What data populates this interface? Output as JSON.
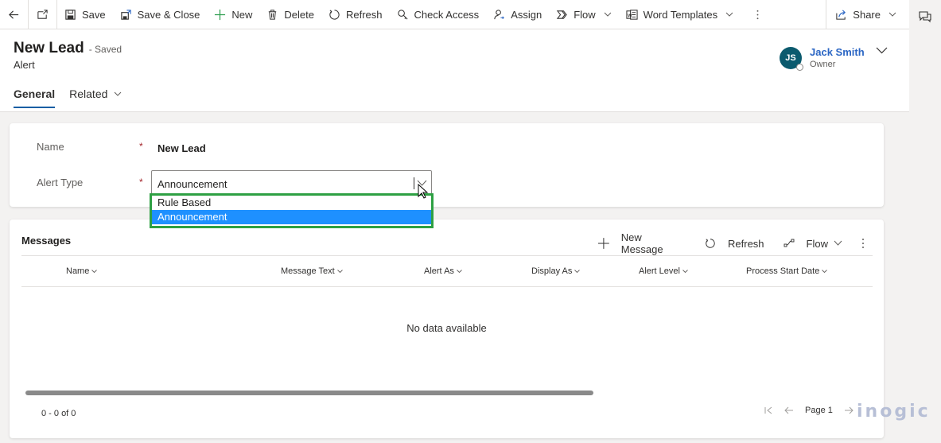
{
  "toolbar": {
    "back_icon": "arrow-left-icon",
    "popout_icon": "open-in-new-window-icon",
    "items": [
      {
        "label": "Save",
        "icon": "save-icon"
      },
      {
        "label": "Save & Close",
        "icon": "save-close-icon"
      },
      {
        "label": "New",
        "icon": "plus-icon"
      },
      {
        "label": "Delete",
        "icon": "trash-icon"
      },
      {
        "label": "Refresh",
        "icon": "refresh-icon"
      },
      {
        "label": "Check Access",
        "icon": "key-search-icon"
      },
      {
        "label": "Assign",
        "icon": "person-assign-icon"
      },
      {
        "label": "Flow",
        "icon": "flow-icon",
        "has_dropdown": true
      },
      {
        "label": "Word Templates",
        "icon": "word-icon",
        "has_dropdown": true
      }
    ],
    "more_icon": "more-vertical-icon",
    "share": {
      "label": "Share",
      "icon": "share-icon",
      "has_dropdown": true
    }
  },
  "rail": {
    "chat_icon": "chat-icon"
  },
  "header": {
    "title": "New Lead",
    "status": "- Saved",
    "entity": "Alert",
    "owner": {
      "initials": "JS",
      "name": "Jack Smith",
      "role": "Owner",
      "avatar_color": "#0b5a6e"
    },
    "tabs": [
      {
        "label": "General",
        "active": true
      },
      {
        "label": "Related",
        "active": false,
        "has_dropdown": true
      }
    ]
  },
  "form": {
    "fields": [
      {
        "label": "Name",
        "required": "*",
        "value": "New Lead"
      },
      {
        "label": "Alert Type",
        "required": "*",
        "value": "Announcement"
      }
    ],
    "dropdown": {
      "options": [
        "Rule Based",
        "Announcement"
      ],
      "selected": "Announcement",
      "highlight_color": "#2ea043",
      "selected_color": "#1e90ff"
    }
  },
  "messages": {
    "title": "Messages",
    "commands": [
      {
        "label": "New Message",
        "icon": "plus-icon"
      },
      {
        "label": "Refresh",
        "icon": "refresh-icon"
      },
      {
        "label": "Flow",
        "icon": "flow-icon",
        "has_dropdown": true
      }
    ],
    "columns": [
      "Name",
      "Message Text",
      "Alert As",
      "Display As",
      "Alert Level",
      "Process Start Date"
    ],
    "empty_text": "No data available",
    "record_count": "0 - 0 of 0",
    "page_label": "Page 1"
  },
  "watermark": "inogic"
}
